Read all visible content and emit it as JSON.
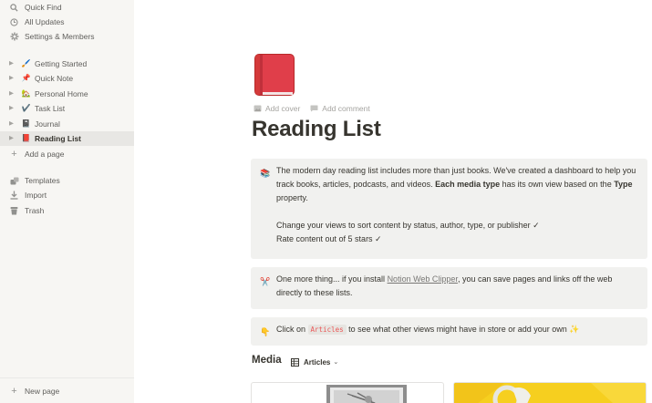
{
  "sidebar": {
    "top_items": [
      {
        "label": "Quick Find",
        "icon": "search-icon"
      },
      {
        "label": "All Updates",
        "icon": "clock-icon"
      },
      {
        "label": "Settings & Members",
        "icon": "gear-icon"
      }
    ],
    "pages": [
      {
        "label": "Getting Started",
        "emoji": "🖌️"
      },
      {
        "label": "Quick Note",
        "emoji": "📌"
      },
      {
        "label": "Personal Home",
        "emoji": "🏡"
      },
      {
        "label": "Task List",
        "emoji": "✔️"
      },
      {
        "label": "Journal",
        "emoji": "📓"
      },
      {
        "label": "Reading List",
        "emoji": "📕"
      }
    ],
    "add_page_label": "Add a page",
    "bottom_items": [
      {
        "label": "Templates",
        "icon": "templates-icon"
      },
      {
        "label": "Import",
        "icon": "import-icon"
      },
      {
        "label": "Trash",
        "icon": "trash-icon"
      }
    ],
    "new_page_label": "New page"
  },
  "page": {
    "icon": "closed-book-icon",
    "add_cover_label": "Add cover",
    "add_comment_label": "Add comment",
    "title": "Reading List"
  },
  "callouts": {
    "intro": {
      "emoji": "📚",
      "text_1": "The modern day reading list includes more than just books. We've created a dashboard to help you track books, articles, podcasts, and videos. ",
      "bold_1": "Each media type",
      "text_2": " has its own view based on the ",
      "bold_2": "Type",
      "text_3": " property.",
      "line_2": "Change your views to sort content by status, author, type, or publisher ✓",
      "line_3": "Rate content out of 5 stars ✓"
    },
    "clipper": {
      "emoji": "✂️",
      "text_1": "One more thing... if you install ",
      "link": "Notion Web Clipper",
      "text_2": ", you can save pages and links off the web directly to these lists."
    },
    "views": {
      "emoji": "👇",
      "text_1": "Click on ",
      "code": "Articles",
      "text_2": " to see what other views might have in store or add your own ✨"
    }
  },
  "database": {
    "title": "Media",
    "view_label": "Articles",
    "view_icon": "table-icon"
  },
  "colors": {
    "sidebar_bg": "#f7f6f3",
    "callout_bg": "#f1f1ef",
    "book_red": "#e03e3e",
    "card_yellow": "#f6cf1f"
  }
}
